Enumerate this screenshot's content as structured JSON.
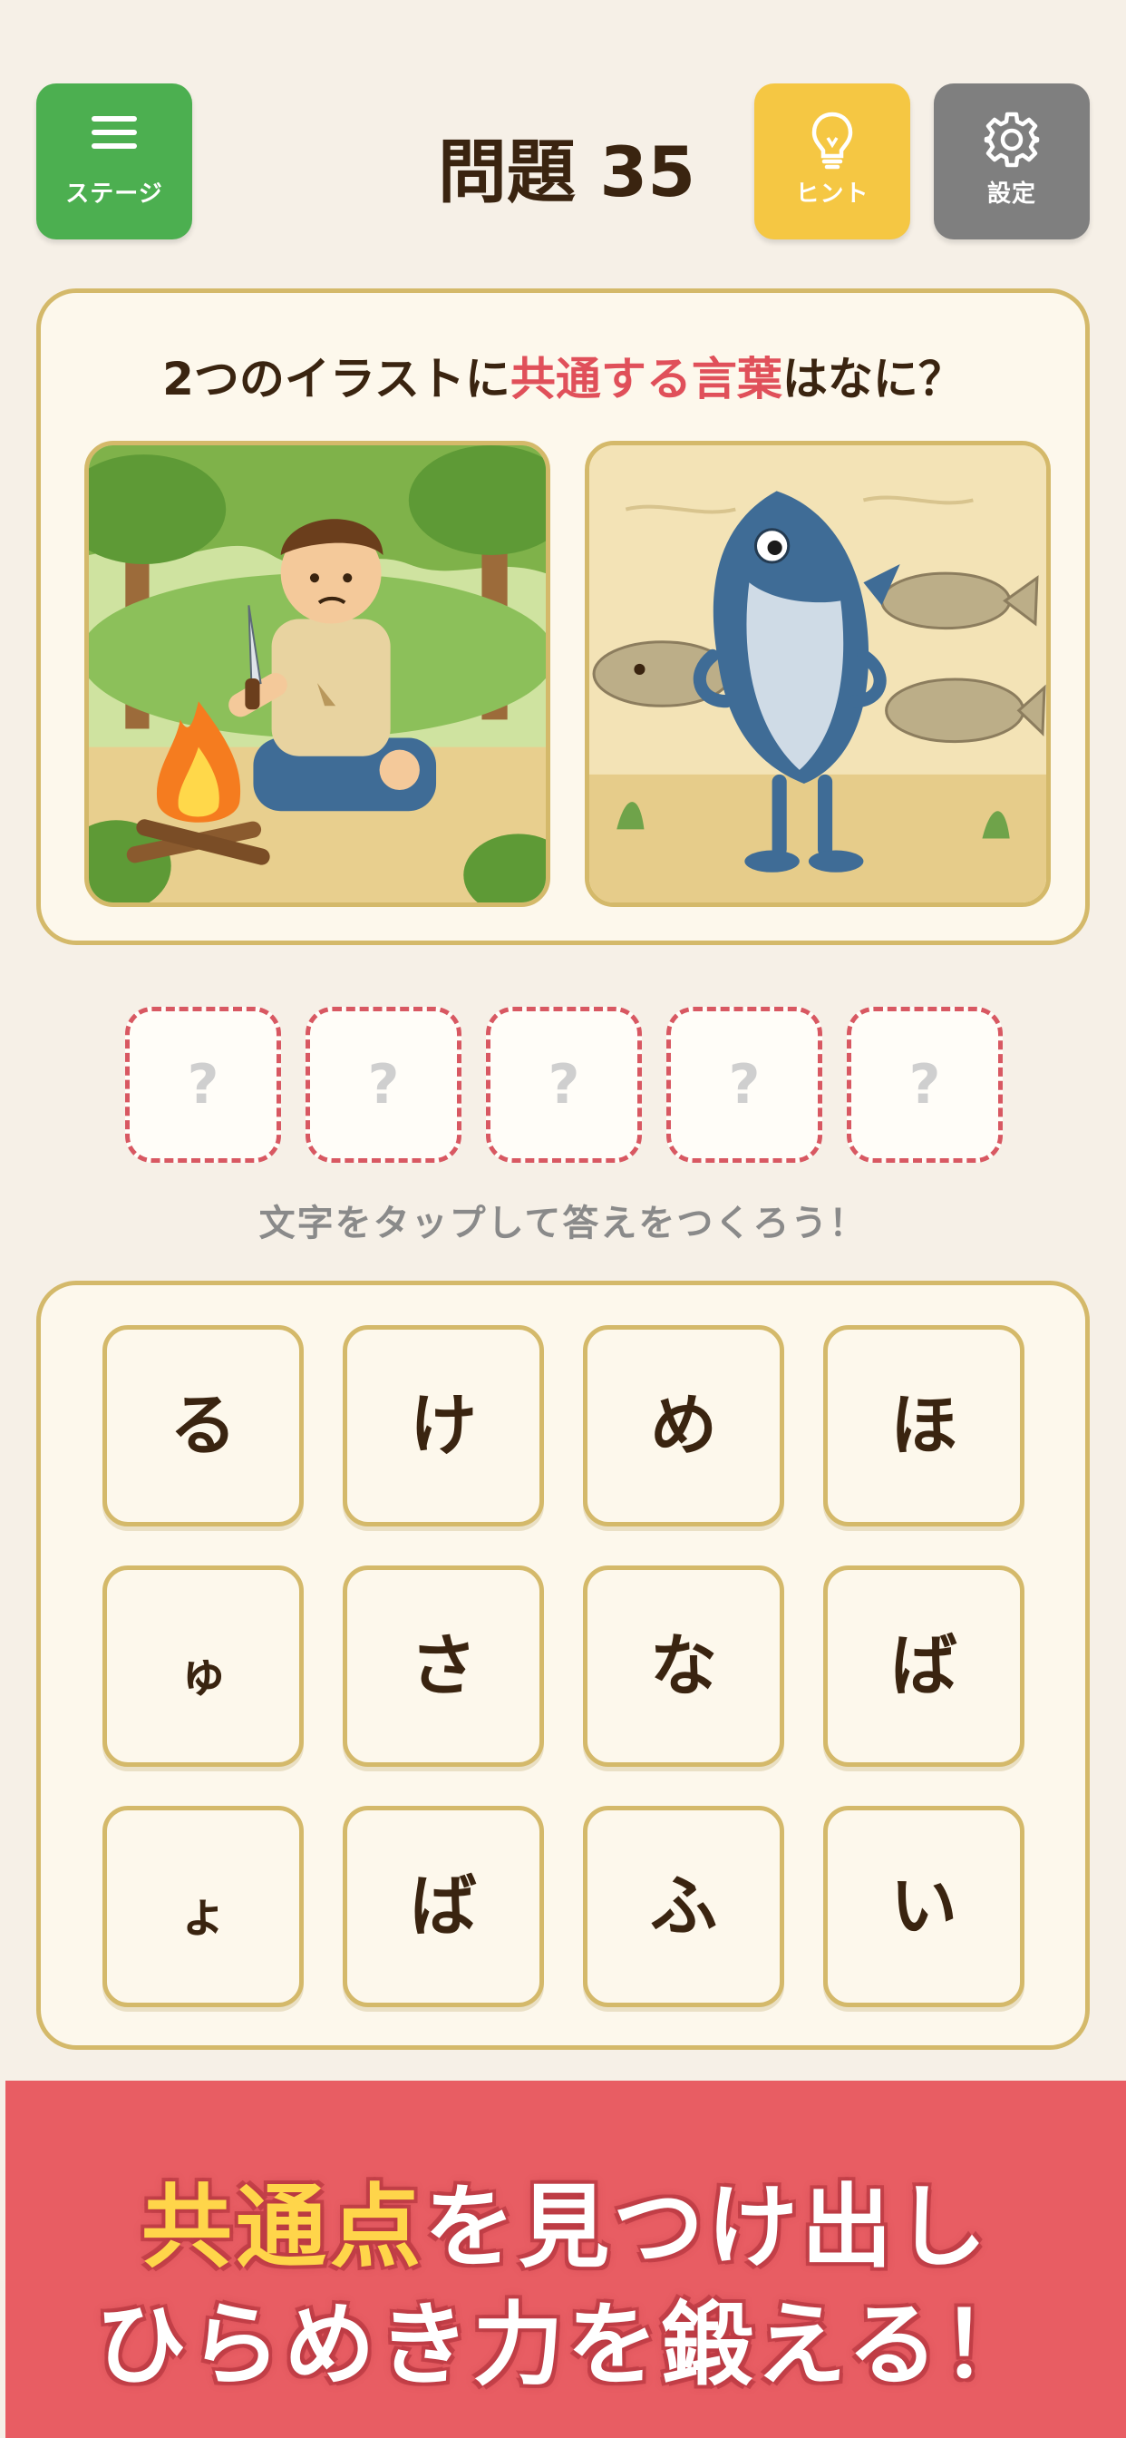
{
  "header": {
    "stage_label": "ステージ",
    "title": "問題 35",
    "hint_label": "ヒント",
    "settings_label": "設定"
  },
  "question": {
    "prefix": "2つのイラストに",
    "accent": "共通する言葉",
    "suffix": "はなに？"
  },
  "answer_slots": [
    "?",
    "?",
    "?",
    "?",
    "?"
  ],
  "instruction": "文字をタップして答えをつくろう！",
  "tiles": [
    "る",
    "け",
    "め",
    "ほ",
    "ゅ",
    "さ",
    "な",
    "ば",
    "ょ",
    "ば",
    "ふ",
    "い"
  ],
  "banner": {
    "line1_highlight": "共通点",
    "line1_rest": "を見つけ出し",
    "line2": "ひらめき力を鍛える！"
  },
  "colors": {
    "stage_button": "#4caf50",
    "hint_button": "#f5c743",
    "settings_button": "#7f7f7f",
    "accent": "#e0505a",
    "banner": "#e85d63",
    "banner_highlight": "#ffd54a"
  },
  "icons": {
    "stage": "hamburger-menu-icon",
    "hint": "lightbulb-icon",
    "settings": "gear-icon"
  }
}
